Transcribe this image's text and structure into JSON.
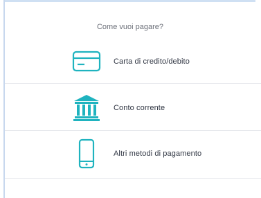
{
  "dialog": {
    "heading": "Come vuoi pagare?"
  },
  "options": [
    {
      "label": "Carta di credito/debito",
      "icon": "credit-card-icon"
    },
    {
      "label": "Conto corrente",
      "icon": "bank-icon"
    },
    {
      "label": "Altri metodi di pagamento",
      "icon": "smartphone-icon"
    }
  ],
  "colors": {
    "accent": "#1fb3bf",
    "text": "#2f3542",
    "muted": "#6b6f78",
    "divider": "#e7e9ed",
    "frame": "#cfe0f3"
  }
}
